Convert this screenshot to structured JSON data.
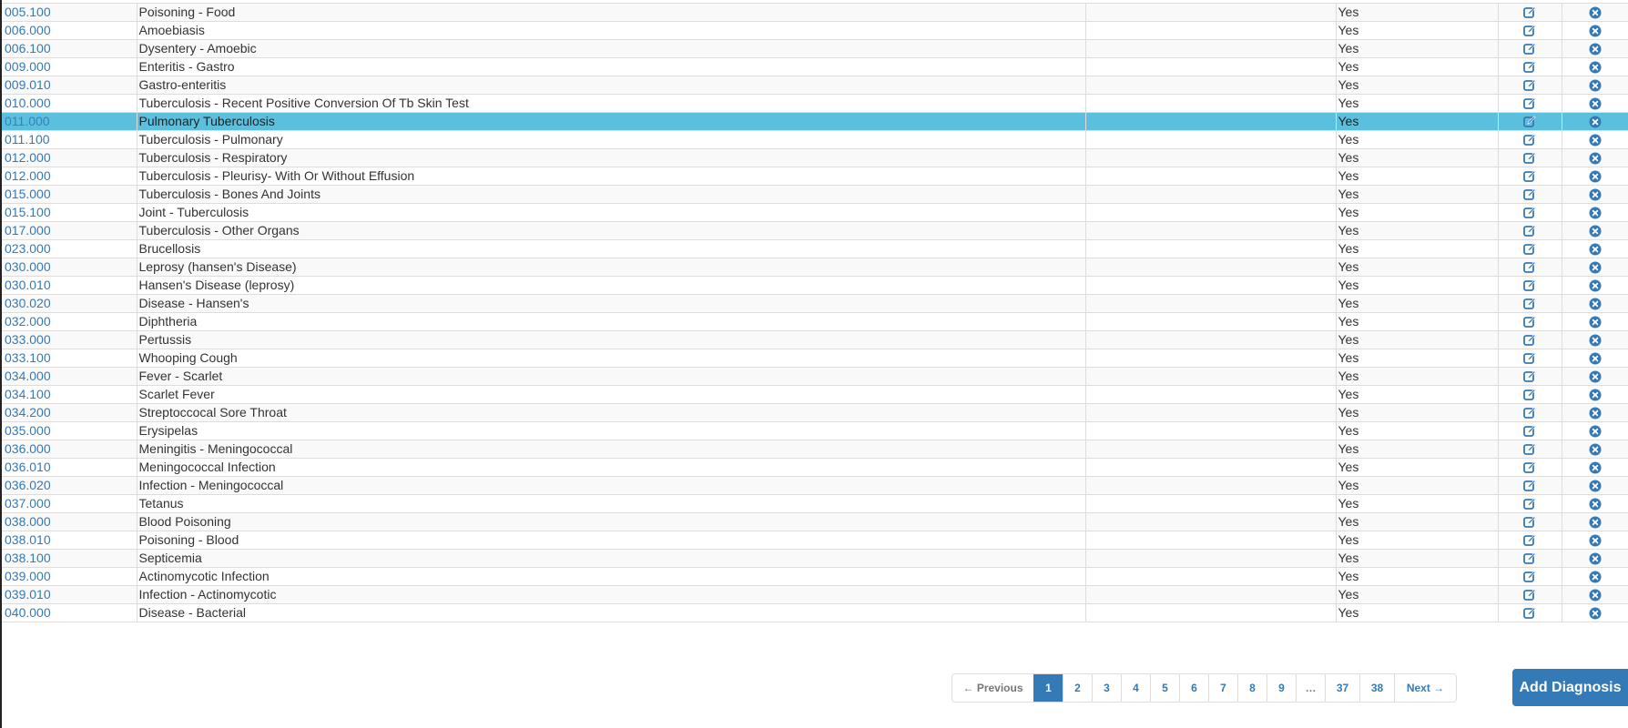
{
  "rows": [
    {
      "code": "005.100",
      "description": "Poisoning - Food",
      "flag": "Yes"
    },
    {
      "code": "006.000",
      "description": "Amoebiasis",
      "flag": "Yes"
    },
    {
      "code": "006.100",
      "description": "Dysentery - Amoebic",
      "flag": "Yes"
    },
    {
      "code": "009.000",
      "description": "Enteritis - Gastro",
      "flag": "Yes"
    },
    {
      "code": "009.010",
      "description": "Gastro-enteritis",
      "flag": "Yes"
    },
    {
      "code": "010.000",
      "description": "Tuberculosis - Recent Positive Conversion Of Tb Skin Test",
      "flag": "Yes"
    },
    {
      "code": "011.000",
      "description": "Pulmonary Tuberculosis",
      "flag": "Yes",
      "highlighted": true
    },
    {
      "code": "011.100",
      "description": "Tuberculosis - Pulmonary",
      "flag": "Yes"
    },
    {
      "code": "012.000",
      "description": "Tuberculosis - Respiratory",
      "flag": "Yes"
    },
    {
      "code": "012.000",
      "description": "Tuberculosis - Pleurisy- With Or Without Effusion",
      "flag": "Yes"
    },
    {
      "code": "015.000",
      "description": "Tuberculosis - Bones And Joints",
      "flag": "Yes"
    },
    {
      "code": "015.100",
      "description": "Joint - Tuberculosis",
      "flag": "Yes"
    },
    {
      "code": "017.000",
      "description": "Tuberculosis - Other Organs",
      "flag": "Yes"
    },
    {
      "code": "023.000",
      "description": "Brucellosis",
      "flag": "Yes"
    },
    {
      "code": "030.000",
      "description": "Leprosy (hansen's Disease)",
      "flag": "Yes"
    },
    {
      "code": "030.010",
      "description": "Hansen's Disease (leprosy)",
      "flag": "Yes"
    },
    {
      "code": "030.020",
      "description": "Disease - Hansen's",
      "flag": "Yes"
    },
    {
      "code": "032.000",
      "description": "Diphtheria",
      "flag": "Yes"
    },
    {
      "code": "033.000",
      "description": "Pertussis",
      "flag": "Yes"
    },
    {
      "code": "033.100",
      "description": "Whooping Cough",
      "flag": "Yes"
    },
    {
      "code": "034.000",
      "description": "Fever - Scarlet",
      "flag": "Yes"
    },
    {
      "code": "034.100",
      "description": "Scarlet Fever",
      "flag": "Yes"
    },
    {
      "code": "034.200",
      "description": "Streptoccocal Sore Throat",
      "flag": "Yes"
    },
    {
      "code": "035.000",
      "description": "Erysipelas",
      "flag": "Yes"
    },
    {
      "code": "036.000",
      "description": "Meningitis - Meningococcal",
      "flag": "Yes"
    },
    {
      "code": "036.010",
      "description": "Meningococcal Infection",
      "flag": "Yes"
    },
    {
      "code": "036.020",
      "description": "Infection - Meningococcal",
      "flag": "Yes"
    },
    {
      "code": "037.000",
      "description": "Tetanus",
      "flag": "Yes"
    },
    {
      "code": "038.000",
      "description": "Blood Poisoning",
      "flag": "Yes"
    },
    {
      "code": "038.010",
      "description": "Poisoning - Blood",
      "flag": "Yes"
    },
    {
      "code": "038.100",
      "description": "Septicemia",
      "flag": "Yes"
    },
    {
      "code": "039.000",
      "description": "Actinomycotic Infection",
      "flag": "Yes"
    },
    {
      "code": "039.010",
      "description": "Infection - Actinomycotic",
      "flag": "Yes"
    },
    {
      "code": "040.000",
      "description": "Disease - Bacterial",
      "flag": "Yes"
    }
  ],
  "icons": {
    "edit": "edit-icon",
    "delete": "remove-circle-icon"
  },
  "pagination": {
    "previous": "← Previous",
    "pages": [
      "1",
      "2",
      "3",
      "4",
      "5",
      "6",
      "7",
      "8",
      "9"
    ],
    "ellipsis": "…",
    "tail_pages": [
      "37",
      "38"
    ],
    "next": "Next →",
    "active": "1"
  },
  "add_button": "Add Diagnosis",
  "colors": {
    "link": "#337ab7",
    "highlight": "#5bc0de",
    "primary": "#337ab7"
  }
}
